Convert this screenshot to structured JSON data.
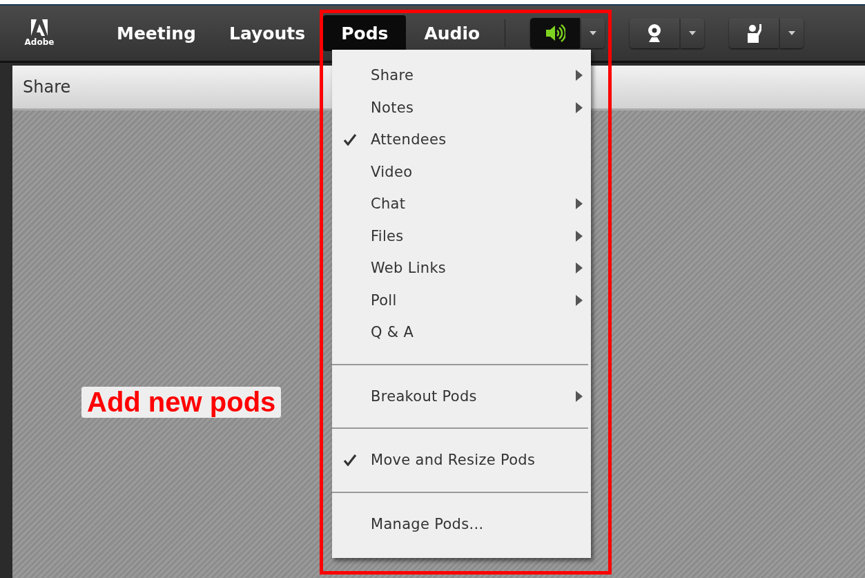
{
  "logo": {
    "text": "Adobe"
  },
  "menu_bar": [
    {
      "label": "Meeting",
      "selected": false
    },
    {
      "label": "Layouts",
      "selected": false
    },
    {
      "label": "Pods",
      "selected": true
    },
    {
      "label": "Audio",
      "selected": false
    }
  ],
  "toolbar_buttons": [
    {
      "kind": "speaker",
      "on": true
    },
    {
      "kind": "camera",
      "on": false
    },
    {
      "kind": "hand",
      "on": false
    }
  ],
  "pod": {
    "title": "Share"
  },
  "pods_menu": {
    "groups": [
      [
        {
          "label": "Share",
          "checked": false,
          "submenu": true
        },
        {
          "label": "Notes",
          "checked": false,
          "submenu": true
        },
        {
          "label": "Attendees",
          "checked": true,
          "submenu": false
        },
        {
          "label": "Video",
          "checked": false,
          "submenu": false
        },
        {
          "label": "Chat",
          "checked": false,
          "submenu": true
        },
        {
          "label": "Files",
          "checked": false,
          "submenu": true
        },
        {
          "label": "Web Links",
          "checked": false,
          "submenu": true
        },
        {
          "label": "Poll",
          "checked": false,
          "submenu": true
        },
        {
          "label": "Q & A",
          "checked": false,
          "submenu": false
        }
      ],
      [
        {
          "label": "Breakout Pods",
          "checked": false,
          "submenu": true
        }
      ],
      [
        {
          "label": "Move and Resize Pods",
          "checked": true,
          "submenu": false
        }
      ],
      [
        {
          "label": "Manage Pods...",
          "checked": false,
          "submenu": false
        }
      ]
    ]
  },
  "annotation": {
    "text": "Add new pods"
  }
}
